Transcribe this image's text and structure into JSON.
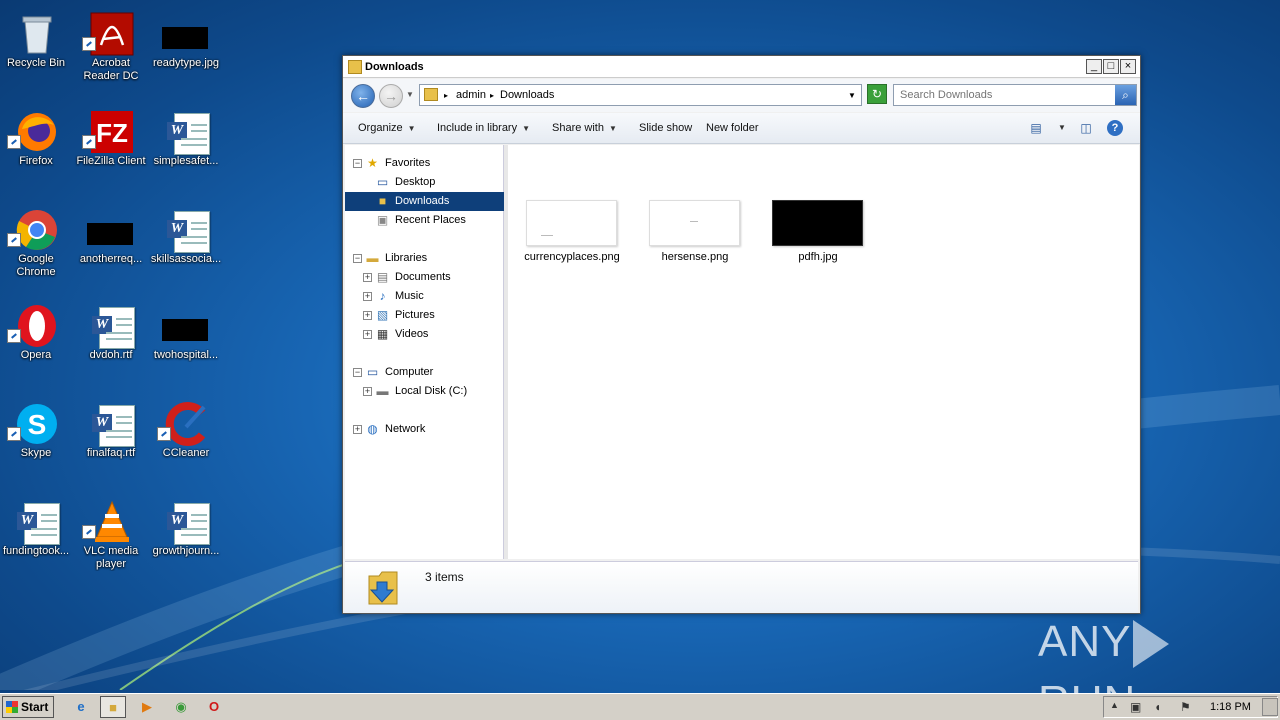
{
  "desktop": {
    "icons": [
      {
        "label": "Recycle Bin",
        "icon": "recycle-bin-icon"
      },
      {
        "label": "Acrobat\nReader DC",
        "icon": "acrobat-reader-icon"
      },
      {
        "label": "readytype.jpg",
        "icon": "image-file-icon"
      },
      {
        "label": "Firefox",
        "icon": "firefox-icon"
      },
      {
        "label": "FileZilla Client",
        "icon": "filezilla-icon"
      },
      {
        "label": "simplesafet...",
        "icon": "word-document-icon"
      },
      {
        "label": "Google\nChrome",
        "icon": "chrome-icon"
      },
      {
        "label": "anotherreq...",
        "icon": "image-file-icon"
      },
      {
        "label": "skillsassocia...",
        "icon": "word-document-icon"
      },
      {
        "label": "Opera",
        "icon": "opera-icon"
      },
      {
        "label": "dvdoh.rtf",
        "icon": "word-document-icon"
      },
      {
        "label": "twohospital...",
        "icon": "image-file-icon"
      },
      {
        "label": "Skype",
        "icon": "skype-icon"
      },
      {
        "label": "finalfaq.rtf",
        "icon": "word-document-icon"
      },
      {
        "label": "CCleaner",
        "icon": "ccleaner-icon"
      },
      {
        "label": "fundingtook...",
        "icon": "word-document-icon"
      },
      {
        "label": "VLC media\nplayer",
        "icon": "vlc-icon"
      },
      {
        "label": "growthjourn...",
        "icon": "word-document-icon"
      }
    ]
  },
  "window": {
    "title": "Downloads",
    "controls": {
      "minimize": "_",
      "maximize": "□",
      "close": "×"
    },
    "address": {
      "crumbs": [
        "admin",
        "Downloads"
      ],
      "separator": "▸"
    },
    "search": {
      "placeholder": "Search Downloads"
    },
    "commands": [
      {
        "label": "Organize",
        "dropdown": true
      },
      {
        "label": "Include in library",
        "dropdown": true
      },
      {
        "label": "Share with",
        "dropdown": true
      },
      {
        "label": "Slide show",
        "dropdown": false
      },
      {
        "label": "New folder",
        "dropdown": false
      }
    ],
    "nav": {
      "favorites": "Favorites",
      "desktop": "Desktop",
      "downloads": "Downloads",
      "recent": "Recent Places",
      "libraries": "Libraries",
      "documents": "Documents",
      "music": "Music",
      "pictures": "Pictures",
      "videos": "Videos",
      "computer": "Computer",
      "localdisk": "Local Disk (C:)",
      "network": "Network"
    },
    "files": [
      {
        "name": "currencyplaces.png",
        "thumb": "light"
      },
      {
        "name": "hersense.png",
        "thumb": "light"
      },
      {
        "name": "pdfh.jpg",
        "thumb": "dark"
      }
    ],
    "status": {
      "count": "3 items"
    }
  },
  "taskbar": {
    "start": "Start",
    "apps": [
      "internet-explorer-icon",
      "windows-explorer-icon",
      "media-player-icon",
      "chrome-icon",
      "opera-icon"
    ],
    "clock": "1:18 PM"
  },
  "watermark": {
    "left": "ANY",
    "right": "RUN"
  },
  "colors": {
    "selection": "#0e3f7a",
    "desktop": "#1866b4"
  }
}
